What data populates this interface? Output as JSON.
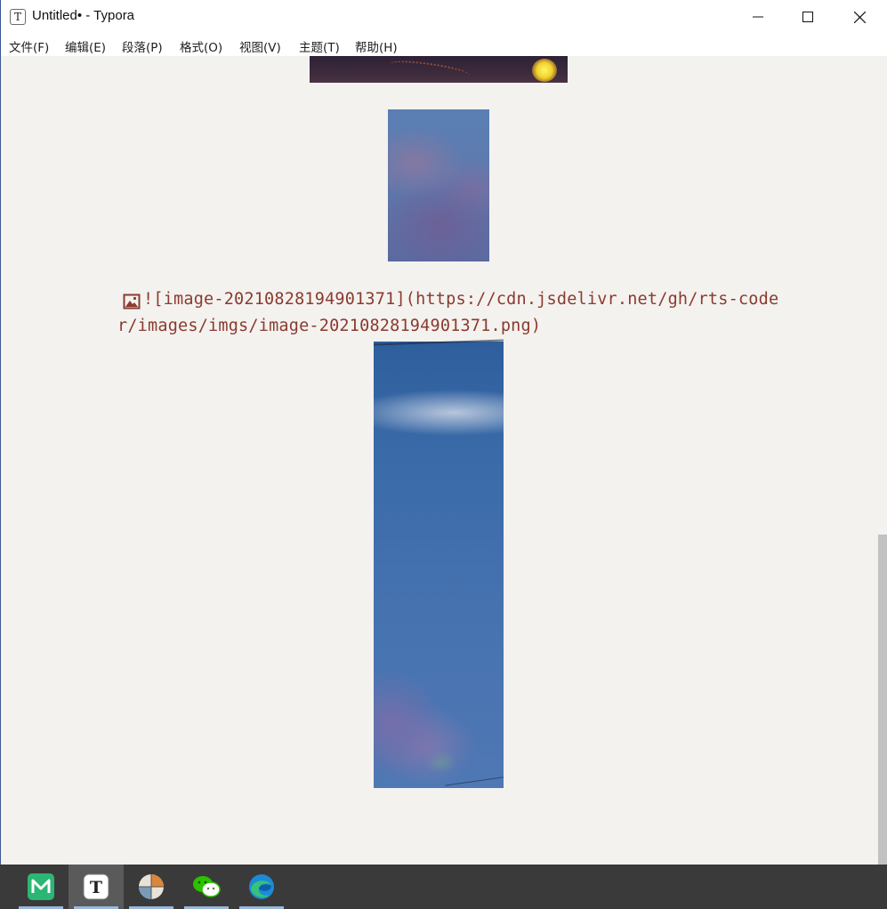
{
  "window": {
    "title": "Untitled• - Typora",
    "app_icon_letter": "T"
  },
  "menu": {
    "items": [
      "文件(F)",
      "编辑(E)",
      "段落(P)",
      "格式(O)",
      "视图(V)",
      "主题(T)",
      "帮助(H)"
    ]
  },
  "document": {
    "markdown_line1": "![image-20210828194901371](https://cdn.jsdelivr.net/gh/rts-code",
    "markdown_line2": "r/images/imgs/image-20210828194901371.png)"
  },
  "taskbar": {
    "apps": [
      "mindmaster-icon",
      "typora-icon",
      "photo-app-icon",
      "wechat-icon",
      "edge-icon"
    ],
    "active_index": 1
  },
  "colors": {
    "markdown_text": "#8b3a2f",
    "background": "#f3f2ef",
    "taskbar": "#3a3a3a"
  }
}
